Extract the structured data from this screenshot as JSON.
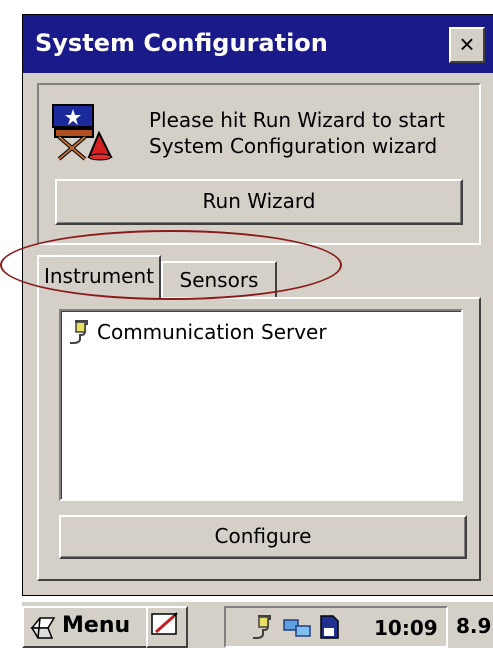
{
  "window": {
    "title": "System Configuration",
    "close_label": "×"
  },
  "wizard": {
    "message_line1": "Please hit Run Wizard to start",
    "message_line2": "System Configuration wizard",
    "run_button": "Run Wizard",
    "icon": "director-chair-icon"
  },
  "tabs": [
    {
      "label": "Instrument",
      "active": true
    },
    {
      "label": "Sensors",
      "active": false
    }
  ],
  "list": {
    "items": [
      {
        "label": "Communication Server",
        "icon": "cable-plug-icon"
      }
    ]
  },
  "configure_button": "Configure",
  "taskbar": {
    "start_label": "Menu",
    "clock": "10:09",
    "extra_text": "8.9"
  },
  "colors": {
    "titlebar": "#1a1a8a",
    "window_bg": "#d4d0c8",
    "highlight": "#8b1a1a"
  }
}
